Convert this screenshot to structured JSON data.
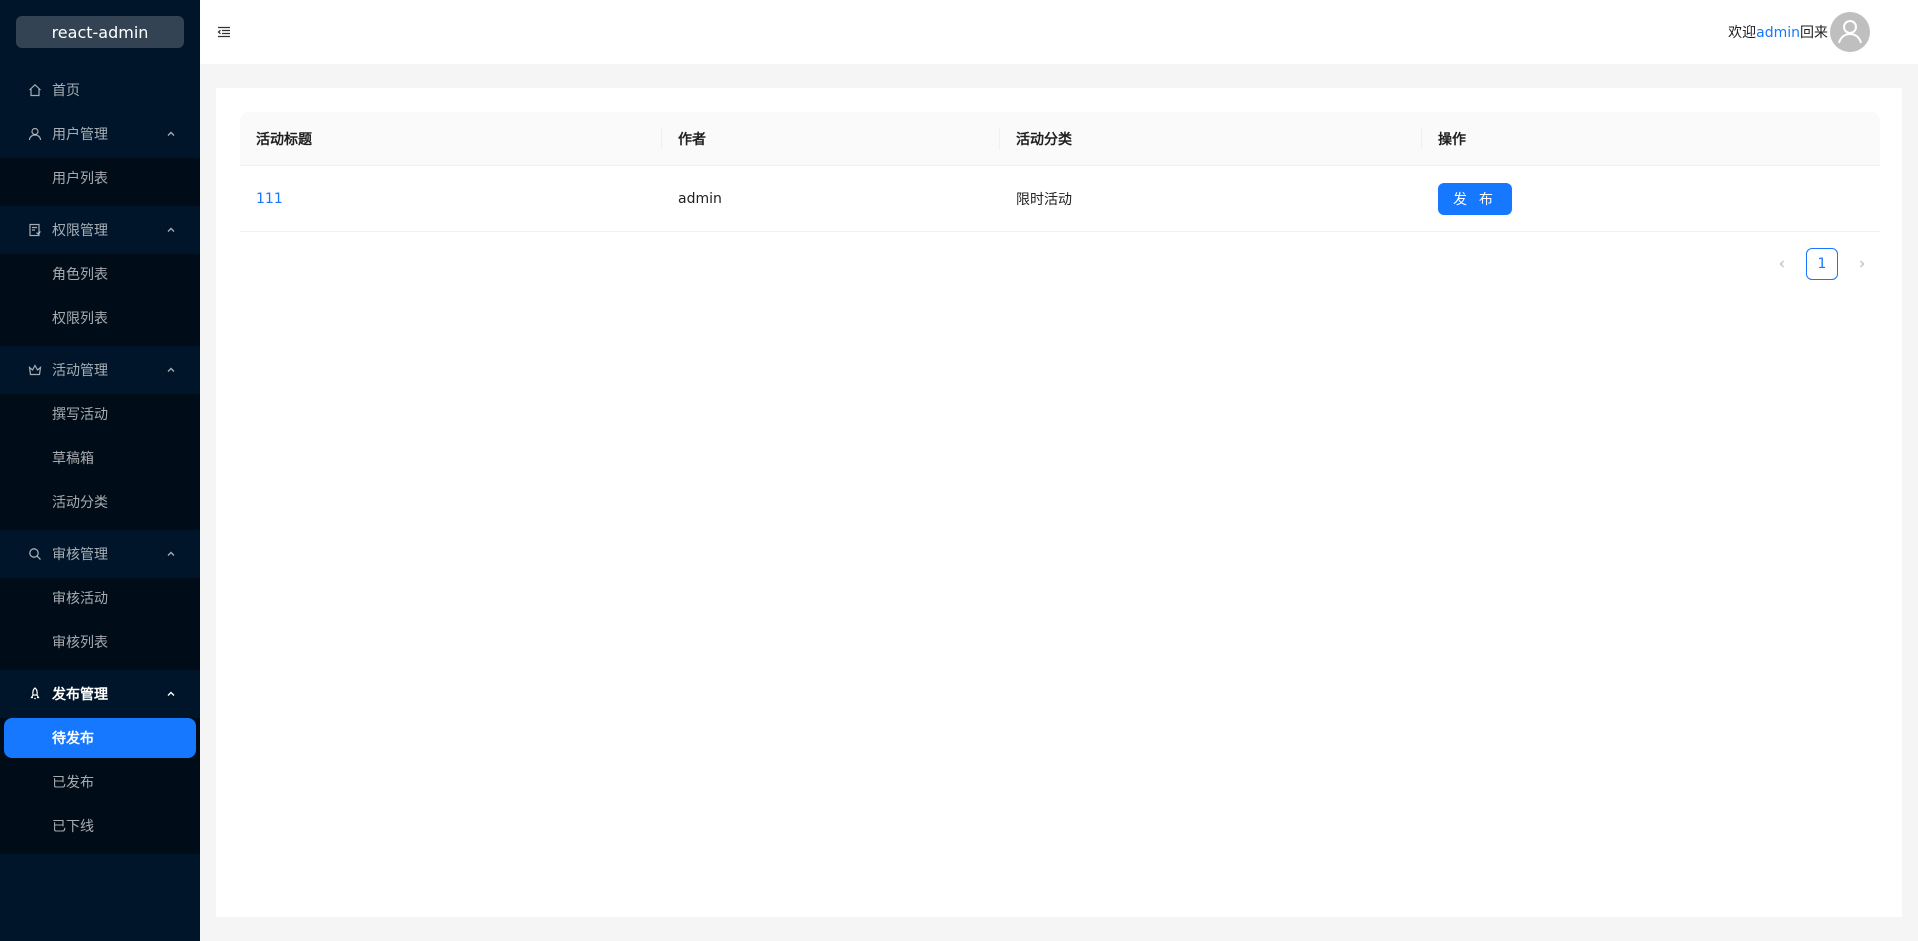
{
  "app": {
    "logo_text": "react-admin"
  },
  "sidebar": {
    "home": {
      "label": "首页"
    },
    "groups": [
      {
        "label": "用户管理",
        "icon": "user-icon",
        "items": [
          {
            "label": "用户列表"
          }
        ]
      },
      {
        "label": "权限管理",
        "icon": "audit-icon",
        "items": [
          {
            "label": "角色列表"
          },
          {
            "label": "权限列表"
          }
        ]
      },
      {
        "label": "活动管理",
        "icon": "crown-icon",
        "items": [
          {
            "label": "撰写活动"
          },
          {
            "label": "草稿箱"
          },
          {
            "label": "活动分类"
          }
        ]
      },
      {
        "label": "审核管理",
        "icon": "search-icon",
        "items": [
          {
            "label": "审核活动"
          },
          {
            "label": "审核列表"
          }
        ]
      },
      {
        "label": "发布管理",
        "icon": "rocket-icon",
        "items": [
          {
            "label": "待发布"
          },
          {
            "label": "已发布"
          },
          {
            "label": "已下线"
          }
        ]
      }
    ]
  },
  "header": {
    "welcome_prefix": "欢迎",
    "username": "admin",
    "welcome_suffix": "回来"
  },
  "table": {
    "columns": [
      "活动标题",
      "作者",
      "活动分类",
      "操作"
    ],
    "rows": [
      {
        "title": "111",
        "author": "admin",
        "category": "限时活动",
        "action": "发 布"
      }
    ]
  },
  "pagination": {
    "current": "1"
  },
  "colors": {
    "primary": "#1677ff",
    "sider": "#001529"
  }
}
